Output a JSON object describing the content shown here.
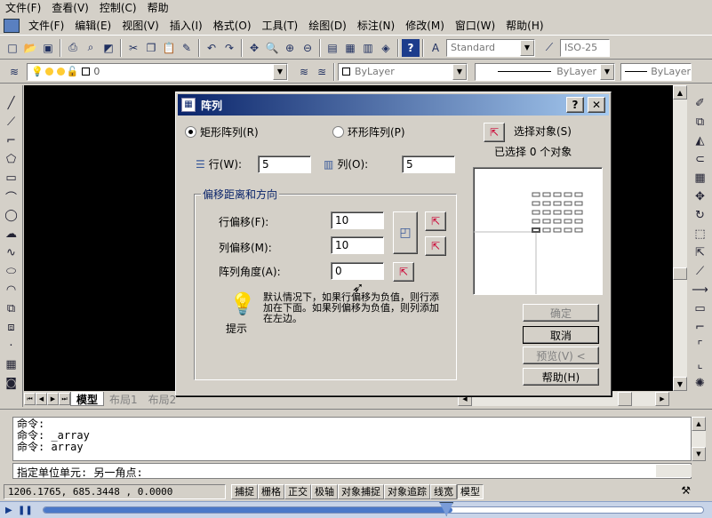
{
  "top_menu": [
    "文件(F)",
    "查看(V)",
    "控制(C)",
    "帮助"
  ],
  "app_menu": [
    "文件(F)",
    "编辑(E)",
    "视图(V)",
    "插入(I)",
    "格式(O)",
    "工具(T)",
    "绘图(D)",
    "标注(N)",
    "修改(M)",
    "窗口(W)",
    "帮助(H)"
  ],
  "toolbar": {
    "text_style": "Standard",
    "dim_style": "ISO-25",
    "layer_value": "0",
    "color": "ByLayer",
    "linetype": "ByLayer",
    "lineweight": "ByLayer"
  },
  "layout_tabs": [
    "模型",
    "布局1",
    "布局2"
  ],
  "dialog": {
    "title": "阵列",
    "rect_label": "矩形阵列(R)",
    "polar_label": "环形阵列(P)",
    "rows_label": "行(W):",
    "rows_value": "5",
    "cols_label": "列(O):",
    "cols_value": "5",
    "group_title": "偏移距离和方向",
    "row_offset_label": "行偏移(F):",
    "row_offset_value": "10",
    "col_offset_label": "列偏移(M):",
    "col_offset_value": "10",
    "angle_label": "阵列角度(A):",
    "angle_value": "0",
    "tip_text": "默认情况下，如果行偏移为负值，则行添加在下面。如果列偏移为负值，则列添加在左边。",
    "tip_label": "提示",
    "select_label": "选择对象(S)",
    "selected_count": "已选择 0 个对象",
    "ok": "确定",
    "cancel": "取消",
    "preview": "预览(V) <",
    "help": "帮助(H)"
  },
  "command": {
    "lines": [
      "命令:",
      "命令: _array",
      "命令: array"
    ],
    "prompt": "指定单位单元:  另一角点:"
  },
  "status": {
    "coords": "1206.1765, 685.3448 , 0.0000",
    "buttons": [
      "捕捉",
      "栅格",
      "正交",
      "极轴",
      "对象捕捉",
      "对象追踪",
      "线宽",
      "模型"
    ]
  }
}
